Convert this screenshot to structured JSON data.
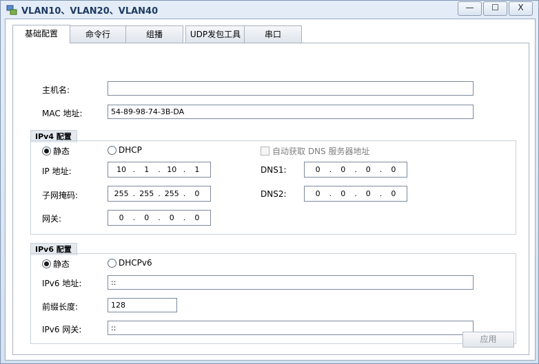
{
  "window": {
    "title": "VLAN10、VLAN20、VLAN40",
    "controls": {
      "minimize": "—",
      "maximize": "☐",
      "close": "X"
    }
  },
  "tabs": [
    {
      "label": "基础配置",
      "active": true
    },
    {
      "label": "命令行",
      "active": false
    },
    {
      "label": "组播",
      "active": false
    },
    {
      "label": "UDP发包工具",
      "active": false
    },
    {
      "label": "串口",
      "active": false
    }
  ],
  "basic": {
    "hostname_label": "主机名:",
    "hostname_value": "",
    "mac_label": "MAC 地址:",
    "mac_value": "54-89-98-74-3B-DA"
  },
  "ipv4": {
    "header": "IPv4 配置",
    "static_label": "静态",
    "dhcp_label": "DHCP",
    "auto_dns_label": "自动获取 DNS 服务器地址",
    "ip_label": "IP 地址:",
    "ip": [
      "10",
      "1",
      "10",
      "1"
    ],
    "mask_label": "子网掩码:",
    "mask": [
      "255",
      "255",
      "255",
      "0"
    ],
    "gateway_label": "网关:",
    "gateway": [
      "0",
      "0",
      "0",
      "0"
    ],
    "dns1_label": "DNS1:",
    "dns1": [
      "0",
      "0",
      "0",
      "0"
    ],
    "dns2_label": "DNS2:",
    "dns2": [
      "0",
      "0",
      "0",
      "0"
    ]
  },
  "ipv6": {
    "header": "IPv6 配置",
    "static_label": "静态",
    "dhcp_label": "DHCPv6",
    "addr_label": "IPv6 地址:",
    "addr_value": "::",
    "prefix_label": "前缀长度:",
    "prefix_value": "128",
    "gateway_label": "IPv6 网关:",
    "gateway_value": "::"
  },
  "apply_button": "应用"
}
